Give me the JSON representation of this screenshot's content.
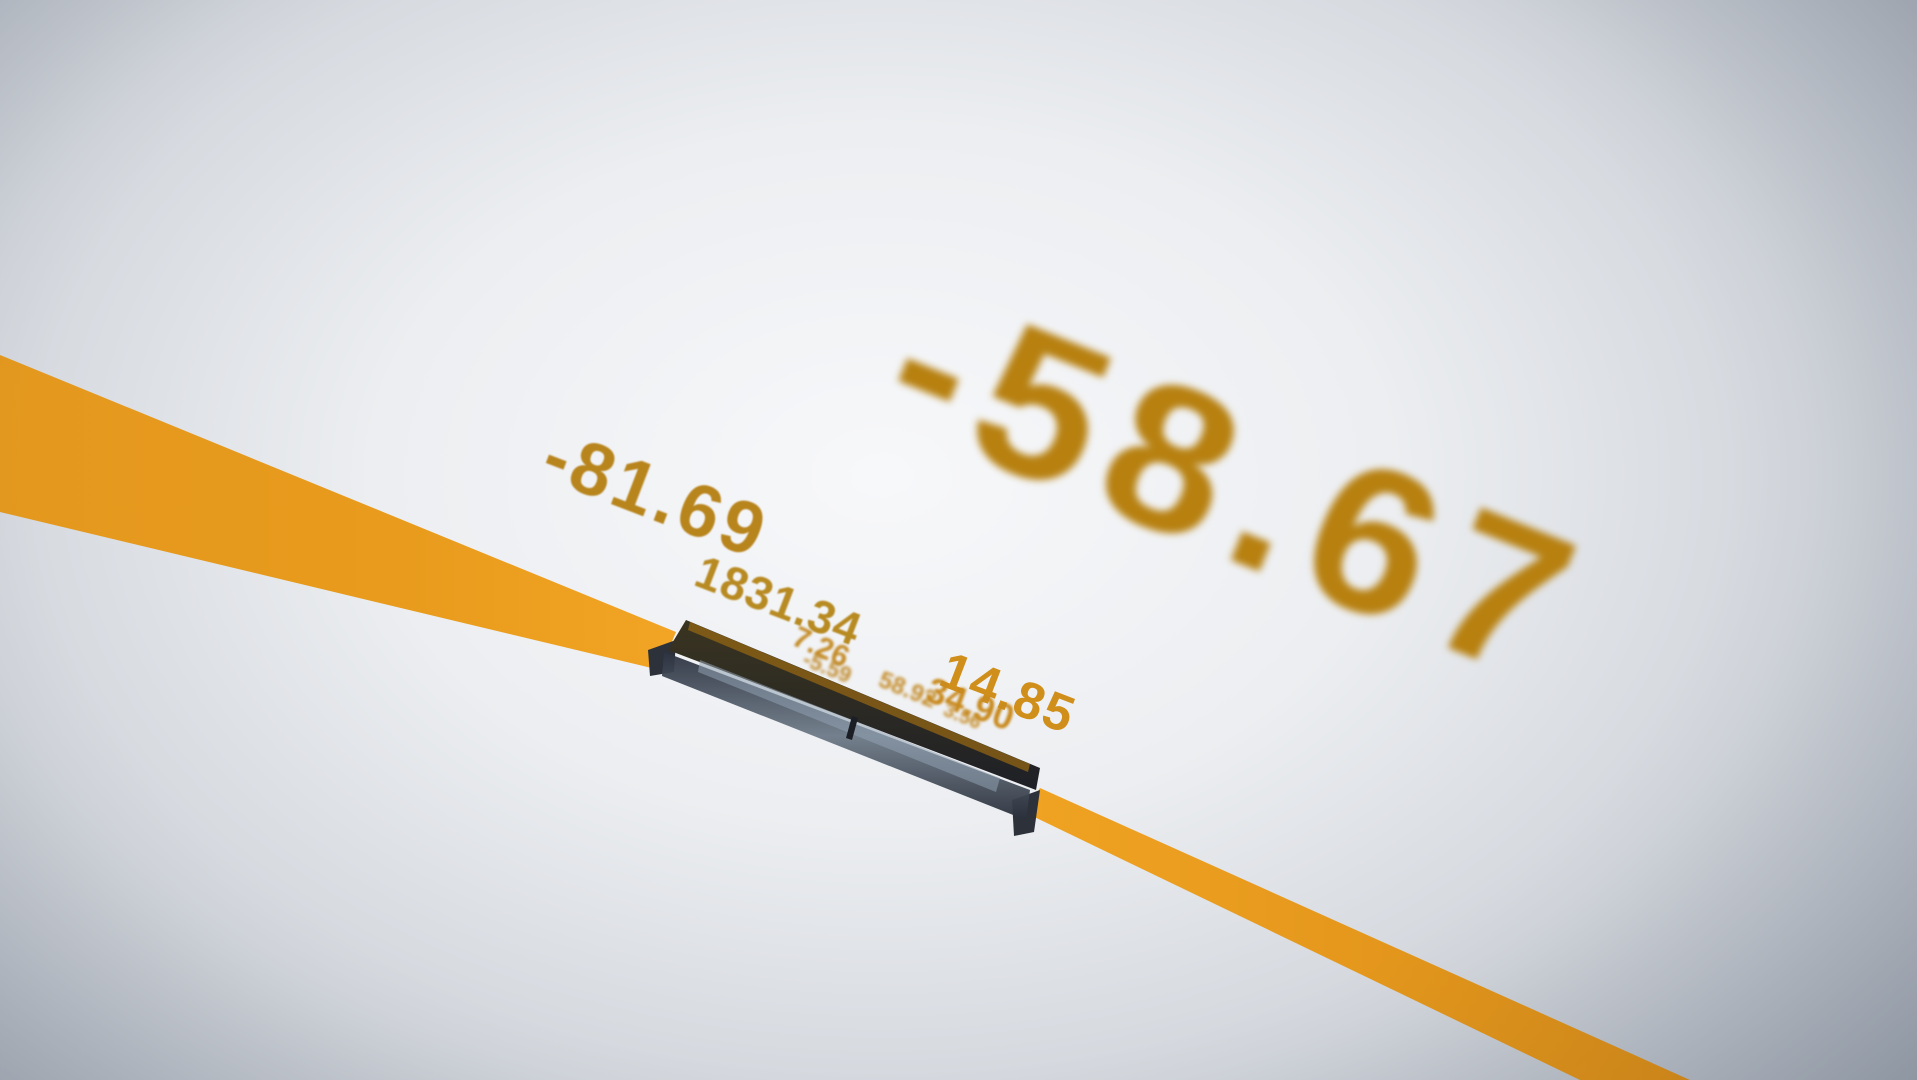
{
  "scene": {
    "numbers": [
      {
        "text": "-58.67"
      },
      {
        "text": "-81.69"
      },
      {
        "text": "1831.34"
      },
      {
        "text": "14.85"
      },
      {
        "text": "34.90"
      },
      {
        "text": "7.26"
      },
      {
        "text": "-5.59"
      },
      {
        "text": "58.92"
      },
      {
        "text": "3.56"
      }
    ],
    "colors": {
      "accent": "#e4981e",
      "accent_dark": "#c98212",
      "accent_light": "#f0a628",
      "device_dark": "#3c4048"
    }
  }
}
